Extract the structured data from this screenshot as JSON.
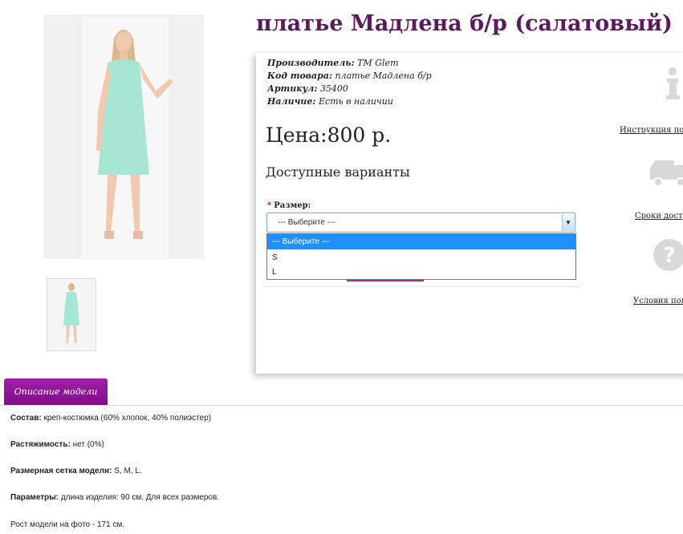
{
  "product": {
    "title": "платье Мадлена б/р (салатовый)",
    "specs": [
      {
        "label": "Производитель:",
        "value": "TM Glem"
      },
      {
        "label": "Код товара:",
        "value": "платье Мадлена б/р"
      },
      {
        "label": "Артикул:",
        "value": "35400"
      },
      {
        "label": "Наличие:",
        "value": "Есть в наличии"
      }
    ],
    "price": "Цена:800 р.",
    "variants_heading": "Доступные варианты",
    "size": {
      "required_mark": "*",
      "label": "Размер:",
      "selected": "--- Выберите ---",
      "options": [
        "--- Выберите ---",
        "S",
        "L"
      ]
    }
  },
  "info_links": {
    "instruction": "Инструкция по",
    "delivery": "Сроки дост",
    "conditions": "Условия пок"
  },
  "icons": {
    "info": "info-icon",
    "truck": "truck-icon",
    "help": "question-icon"
  },
  "description": {
    "tab_label": "Описание модели",
    "lines": [
      {
        "label": "Состав:",
        "text": " креп-костюмка (60% хлопок, 40% полиэстер)"
      },
      {
        "label": "Растяжимость:",
        "text": " нет (0%)"
      },
      {
        "label": "Размерная сетка модели:",
        "text": " S, M, L."
      },
      {
        "label": "Параметры:",
        "text": " длина изделия: 90 см. Для всех размеров."
      },
      {
        "label": "",
        "text": "Рост модели на фото - 171 см."
      }
    ]
  },
  "colors": {
    "title": "#5b1a5b",
    "tab": "#9a1aa0",
    "dress": "#a8e6d4",
    "accent": "#c0267f"
  }
}
